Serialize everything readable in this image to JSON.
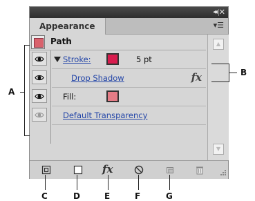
{
  "panel": {
    "collapse_label": "◂◂",
    "close_label": "✕",
    "tab_label": "Appearance",
    "menu_label": "▾☰"
  },
  "object": {
    "label": "Path",
    "swatch_color": "#d9626c"
  },
  "rows": {
    "stroke": {
      "label": "Stroke:",
      "weight": "5 pt",
      "color": "#d81c4e"
    },
    "drop_shadow": {
      "label": "Drop Shadow",
      "fx": "fx"
    },
    "fill": {
      "label": "Fill:",
      "color": "#e47c86"
    },
    "transparency": {
      "label": "Default Transparency"
    }
  },
  "scrollbar": {
    "up": "▲",
    "down": "▼"
  },
  "toolbar": {
    "fx_label": "fx"
  },
  "callouts": {
    "A": "A",
    "B": "B",
    "C": "C",
    "D": "D",
    "E": "E",
    "F": "F",
    "G": "G"
  }
}
